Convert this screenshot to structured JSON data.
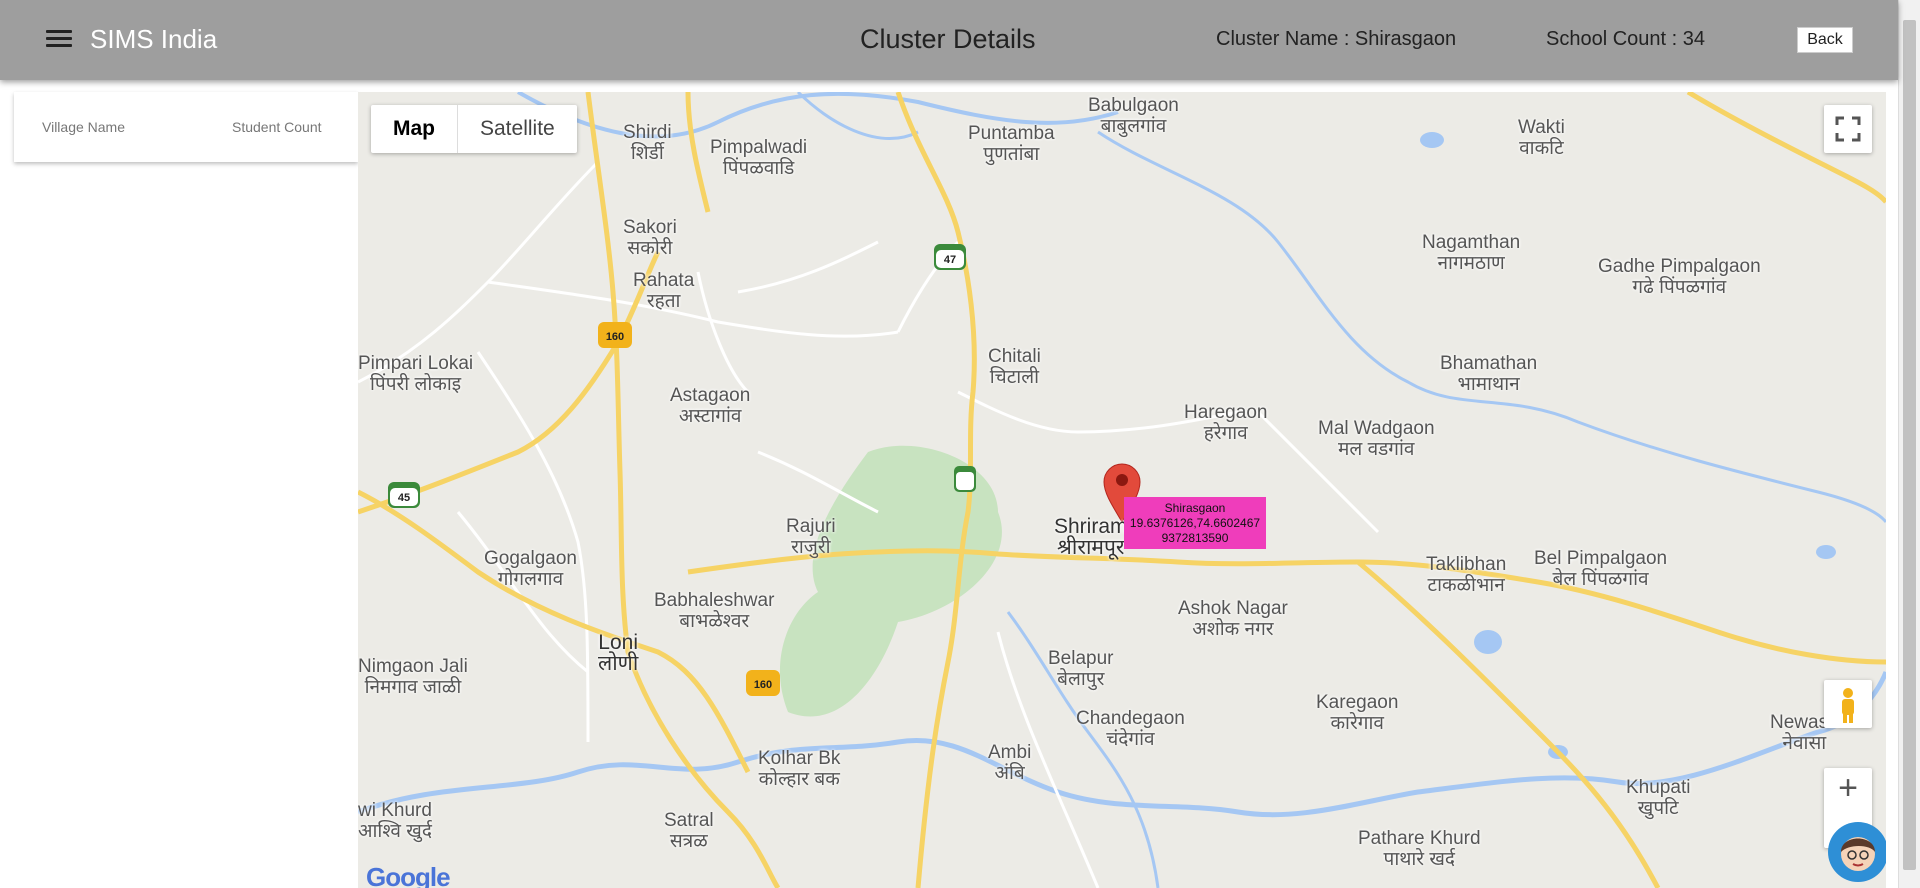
{
  "header": {
    "app_title": "SIMS India",
    "page_title": "Cluster Details",
    "cluster_name": "Cluster Name : Shirasgaon",
    "school_count": "School Count : 34",
    "back_label": "Back"
  },
  "side_panel": {
    "col_village": "Village Name",
    "col_students": "Student Count"
  },
  "map": {
    "map_type_options": [
      "Map",
      "Satellite"
    ],
    "selected_map_type": "Map",
    "marker": {
      "name": "Shirasgaon",
      "coords": "19.6376126,74.6602467",
      "phone": "9372813590",
      "color": "#ef3dbb"
    },
    "places": [
      {
        "en": "Babulgaon",
        "mr": "बाबुलगांव"
      },
      {
        "en": "Shirdi",
        "mr": "शिर्डी"
      },
      {
        "en": "Puntamba",
        "mr": "पुणतांबा"
      },
      {
        "en": "Pimpalwadi",
        "mr": "पिंपळवाडि"
      },
      {
        "en": "Wakti",
        "mr": "वाकटि"
      },
      {
        "en": "Sakori",
        "mr": "सकोरी"
      },
      {
        "en": "Nagamthan",
        "mr": "नागमठाण"
      },
      {
        "en": "Rahata",
        "mr": "रहता"
      },
      {
        "en": "Gadhe Pimpalgaon",
        "mr": "गढे पिंपळगांव"
      },
      {
        "en": "Chitali",
        "mr": "चिटाली"
      },
      {
        "en": "Pimpari Lokai",
        "mr": "पिंपरी लोकाइ"
      },
      {
        "en": "Bhamathan",
        "mr": "भामाथान"
      },
      {
        "en": "Astagaon",
        "mr": "अस्टागांव"
      },
      {
        "en": "Haregaon",
        "mr": "हरेगाव"
      },
      {
        "en": "Mal Wadgaon",
        "mr": "मल वडगांव"
      },
      {
        "en": "Rajuri",
        "mr": "राजुरी"
      },
      {
        "en": "Shriram",
        "mr": "श्रीरामपूर"
      },
      {
        "en": "Gogalgaon",
        "mr": "गोगलगाव"
      },
      {
        "en": "Taklibhan",
        "mr": "टाकळीभान"
      },
      {
        "en": "Bel Pimpalgaon",
        "mr": "बेल पिंपळगांव"
      },
      {
        "en": "Babhaleshwar",
        "mr": "बाभळेश्वर"
      },
      {
        "en": "Ashok Nagar",
        "mr": "अशोक नगर"
      },
      {
        "en": "Loni",
        "mr": "लोणी"
      },
      {
        "en": "Belapur",
        "mr": "बेलापुर"
      },
      {
        "en": "Nimgaon Jali",
        "mr": "निमगाव जाळी"
      },
      {
        "en": "Karegaon",
        "mr": "कारेगाव"
      },
      {
        "en": "Chandegaon",
        "mr": "चंदेगांव"
      },
      {
        "en": "Kolhar Bk",
        "mr": "कोल्हार बक"
      },
      {
        "en": "Ambi",
        "mr": "अंबि"
      },
      {
        "en": "Newasa",
        "mr": "नेवासा"
      },
      {
        "en": "Khupati",
        "mr": "खुपटि"
      },
      {
        "en": "wi Khurd",
        "mr": "आश्वि खुर्द"
      },
      {
        "en": "Satral",
        "mr": "सत्रळ"
      },
      {
        "en": "Pathare Khurd",
        "mr": "पाथारे खर्द"
      }
    ],
    "highways": [
      "47",
      "160",
      "45",
      "160"
    ],
    "logo": "Google",
    "colors": {
      "road": "#f6d365",
      "water": "#a5c7f3",
      "green": "#c8e3c0",
      "land": "#ecebe6"
    }
  }
}
